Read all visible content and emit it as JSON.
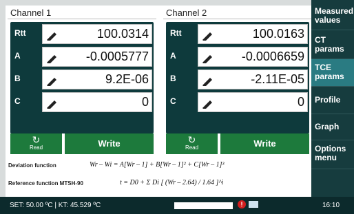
{
  "channels": [
    {
      "title": "Channel 1",
      "rows": [
        {
          "label": "Rtt",
          "value": "100.0314"
        },
        {
          "label": "A",
          "value": "-0.0005777"
        },
        {
          "label": "B",
          "value": "9.2E-06"
        },
        {
          "label": "C",
          "value": "0"
        }
      ],
      "read_label": "Read",
      "write_label": "Write"
    },
    {
      "title": "Channel 2",
      "rows": [
        {
          "label": "Rtt",
          "value": "100.0163"
        },
        {
          "label": "A",
          "value": "-0.0006659"
        },
        {
          "label": "B",
          "value": "-2.11E-05"
        },
        {
          "label": "C",
          "value": "0"
        }
      ],
      "read_label": "Read",
      "write_label": "Write"
    }
  ],
  "formulas": {
    "deviation_label": "Deviation function",
    "deviation_eq": "Wr – Wi = A[Wr – 1] + B[Wr – 1]² + C[Wr – 1]³",
    "reference_label": "Reference function MTSH-90",
    "reference_eq": "t = D0 + Σ Di [ (Wr – 2.64) / 1.64 ]^i"
  },
  "sidebar": {
    "items": [
      {
        "label": "Measured values"
      },
      {
        "label": "CT params"
      },
      {
        "label": "TCE params"
      },
      {
        "label": "Profile"
      },
      {
        "label": "Graph"
      },
      {
        "label": "Options menu"
      }
    ]
  },
  "status": {
    "text": "SET: 50.00 ºC | KT: 45.529 ºC",
    "time": "16:10",
    "warning_symbol": "!"
  },
  "colors": {
    "accent": "#1d7a3c",
    "dark": "#0e3a3c",
    "sidebar_active": "#2a7b82"
  }
}
